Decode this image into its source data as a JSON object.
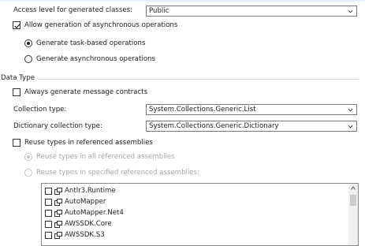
{
  "access_level": {
    "label": "Access level for generated classes:",
    "value": "Public"
  },
  "async": {
    "label": "Allow generation of asynchronous operations",
    "checked": true,
    "options": [
      {
        "label": "Generate task-based operations",
        "selected": true
      },
      {
        "label": "Generate asynchronous operations",
        "selected": false
      }
    ]
  },
  "data_type": {
    "section_title": "Data Type",
    "message_contracts": {
      "label": "Always generate message contracts",
      "checked": false
    },
    "collection_type": {
      "label": "Collection type:",
      "value": "System.Collections.Generic.List"
    },
    "dictionary_type": {
      "label": "Dictionary collection type:",
      "value": "System.Collections.Generic.Dictionary"
    },
    "reuse_types": {
      "label": "Reuse types in referenced assemblies",
      "checked": false
    },
    "reuse_options": [
      {
        "label": "Reuse types in all referenced assemblies",
        "selected": true
      },
      {
        "label": "Reuse types in specified referenced assemblies:",
        "selected": false
      }
    ],
    "assemblies": [
      {
        "name": "Antlr3.Runtime",
        "checked": false
      },
      {
        "name": "AutoMapper",
        "checked": false
      },
      {
        "name": "AutoMapper.Net4",
        "checked": false
      },
      {
        "name": "AWSSDK.Core",
        "checked": false
      },
      {
        "name": "AWSSDK.S3",
        "checked": false
      }
    ]
  },
  "icons": {
    "dropdown": "chevron-down-icon",
    "assembly": "assembly-icon",
    "scroll_up": "scroll-up-arrow-icon"
  },
  "colors": {
    "border": "#7a7a7a",
    "disabled_text": "#a8a8a8",
    "list_border": "#828790"
  }
}
